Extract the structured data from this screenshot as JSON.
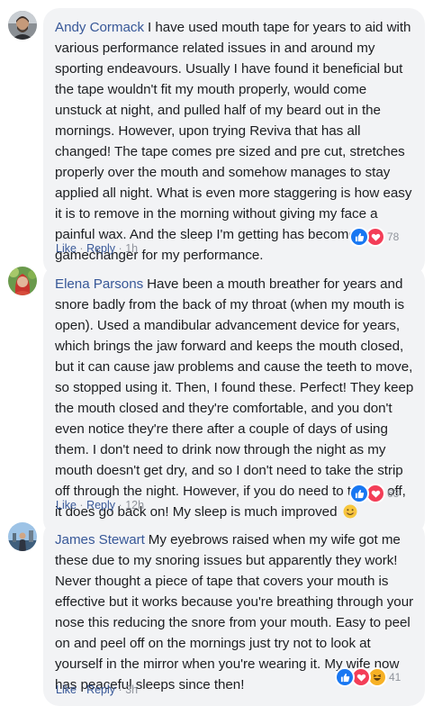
{
  "comments": [
    {
      "author": "Andy Cormack",
      "text": "I have used mouth tape for years to aid with various performance related issues in and around my sporting endeavours. Usually I have found it beneficial but the tape wouldn't fit my mouth properly, would come unstuck at night, and pulled half of my beard out in the mornings. However, upon trying Reviva that has all changed! The tape comes pre sized and pre cut, stretches properly over the mouth and somehow manages to stay applied all night. What is even more staggering is how easy it is to remove in the morning without giving my face a painful wax. And the sleep I'm getting has become a gamechanger for my performance.",
      "reactions": [
        "like-icon",
        "love-icon"
      ],
      "reaction_count": "78",
      "like_label": "Like",
      "sep1": "·",
      "reply_label": "Reply",
      "sep2": "·",
      "time": "1h"
    },
    {
      "author": "Elena Parsons",
      "text": "Have been a mouth breather for years and snore badly from the back of my throat (when my mouth is open). Used a mandibular advancement device for years, which brings the jaw forward and keeps the mouth closed, but it can cause jaw problems and cause the teeth to move, so stopped using it. Then, I found these. Perfect! They keep the mouth closed and they're comfortable, and you don't even notice they're there after a couple of days of using them. I don't need to drink now through the night as my mouth doesn't get dry, and so I don't need to take the strip off through the night. However, if you do need to take it off, it does go back on! My sleep is much improved",
      "emoji": "smile-emoji",
      "reactions": [
        "like-icon",
        "love-icon"
      ],
      "reaction_count": "63",
      "like_label": "Like",
      "sep1": "·",
      "reply_label": "Reply",
      "sep2": "·",
      "time": "12h"
    },
    {
      "author": "James Stewart",
      "text": "My eyebrows raised when my wife got me these due to my snoring issues but apparently they work! Never thought a piece of tape that covers your mouth is effective but it works because you're breathing through your nose this reducing the snore from your mouth. Easy to peel on and peel off on the mornings just try not to look at yourself in the mirror when you're wearing it. My wife now has peaceful sleeps since then!",
      "reactions": [
        "like-icon",
        "love-icon",
        "haha-icon"
      ],
      "reaction_count": "41",
      "like_label": "Like",
      "sep1": "·",
      "reply_label": "Reply",
      "sep2": "·",
      "time": "3h"
    }
  ],
  "colors": {
    "author": "#385898",
    "bubble": "#f2f3f5",
    "meta": "#90949c",
    "like": "#1877f2",
    "love": "#f33e58",
    "haha": "#f7b125"
  }
}
